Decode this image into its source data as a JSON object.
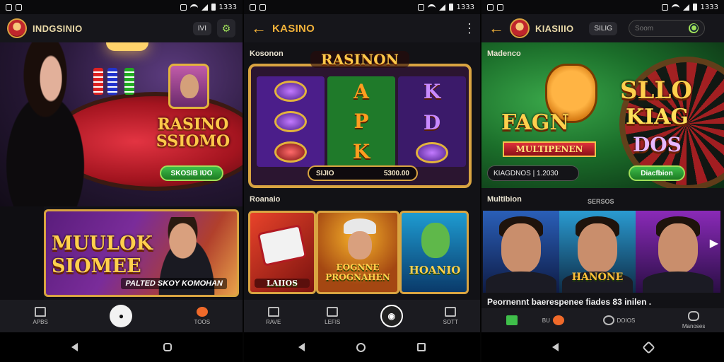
{
  "statusbar": {
    "time": "1333"
  },
  "screen1": {
    "app_title": "INDGSINIO",
    "chip_label": "IVI",
    "hero": {
      "title": "RASINO SSIOMO",
      "button": "SKOSIB IƲO"
    },
    "promo": {
      "title": "MUULOK SIOMEE",
      "caption": "PALTED SKOY KOMOHAN"
    },
    "nav": [
      {
        "label": "APBS",
        "icon": "home-icon"
      },
      {
        "label": "",
        "icon": "profile-icon"
      },
      {
        "label": "TOOS",
        "icon": "flame-icon"
      }
    ]
  },
  "screen2": {
    "app_title": "KASINO",
    "section1_label": "Kosonon",
    "slot_title": "RASINON",
    "reels": [
      {
        "symbols": [
          "",
          "",
          ""
        ],
        "color": "#4b1e8a"
      },
      {
        "symbols": [
          "A",
          "P",
          "K"
        ],
        "color": "#1f7a2a"
      },
      {
        "symbols": [
          "K",
          "D",
          ""
        ],
        "color": "#3b1a6a"
      }
    ],
    "balance": {
      "label": "SIJIO",
      "amount": "5300.00"
    },
    "section2_label": "Roanaio",
    "tiles": [
      {
        "caption": "LAIIOS"
      },
      {
        "caption": "EOGNNE PROGNAHEN"
      },
      {
        "caption": "HOANIO"
      }
    ],
    "nav": [
      {
        "label": "RAVE",
        "icon": "home-icon"
      },
      {
        "label": "LEFIS",
        "icon": "book-icon"
      },
      {
        "label": "",
        "icon": "chip-icon"
      },
      {
        "label": "SOTT",
        "icon": "share-icon"
      }
    ]
  },
  "screen3": {
    "app_title": "KIASIIIO",
    "chip_label": "SILIG",
    "search": {
      "placeholder": "Soom"
    },
    "section1_label": "Madenco",
    "hero": {
      "line1": "SLLO",
      "line2": "KIAG",
      "line3": "DOS",
      "left_title": "FAGN",
      "ribbon": "MULTIPENEN",
      "stat": "KIAGDNOS | 1.2030",
      "button": "Diacfbion"
    },
    "section2_label": "Multibion",
    "section2_extra": "SERSOS",
    "portrait_caption": "HANONE",
    "subtitle": "Peornennt baerespenee fiades 83 inilen .",
    "nav": [
      {
        "label": "",
        "icon": "grid-icon"
      },
      {
        "label": "BU",
        "icon": "coin-icon"
      },
      {
        "label": "DOIOS",
        "icon": "search-icon"
      },
      {
        "label": "Manoses",
        "icon": "controller-icon"
      }
    ]
  }
}
